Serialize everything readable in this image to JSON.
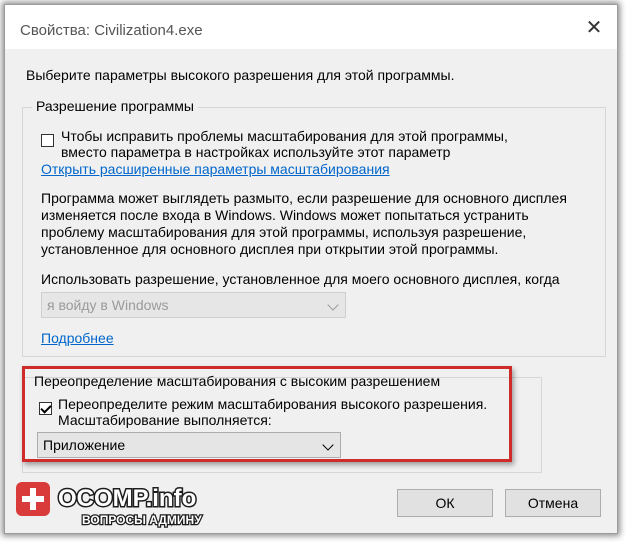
{
  "window": {
    "title": "Свойства: Civilization4.exe",
    "close_glyph": "✕"
  },
  "intro_text": "Выберите параметры высокого разрешения для этой программы.",
  "program_resolution": {
    "legend": "Разрешение программы",
    "checkbox_line1": "Чтобы исправить проблемы масштабирования для этой программы,",
    "checkbox_line2": "вместо параметра в настройках используйте этот параметр",
    "checkbox_checked": false,
    "advanced_link": "Открыть расширенные параметры масштабирования",
    "desc_lines": [
      "Программа может выглядеть размыто, если разрешение для основного дисплея",
      "изменяется после входа в Windows. Windows может попытаться устранить",
      "проблему масштабирования для этой программы, используя разрешение,",
      "установленное для основного дисплея при открытии этой программы."
    ],
    "use_resolution_label": "Использовать разрешение, установленное для моего основного дисплея, когда",
    "when_select_value": "я войду в Windows",
    "more_link": "Подробнее"
  },
  "high_dpi_override": {
    "legend": "Переопределение масштабирования с высоким разрешением",
    "checkbox_line1": "Переопределите режим масштабирования высокого разрешения.",
    "checkbox_line2": "Масштабирование выполняется:",
    "checkbox_checked": true,
    "select_value": "Приложение"
  },
  "buttons": {
    "ok": "ОК",
    "cancel": "Отмена"
  },
  "watermark": {
    "brand": "OCOMP.info",
    "tagline": "ВОПРОСЫ АДМИНУ"
  },
  "colors": {
    "highlight_red": "#cf2b2b",
    "link_blue": "#0066cc"
  }
}
